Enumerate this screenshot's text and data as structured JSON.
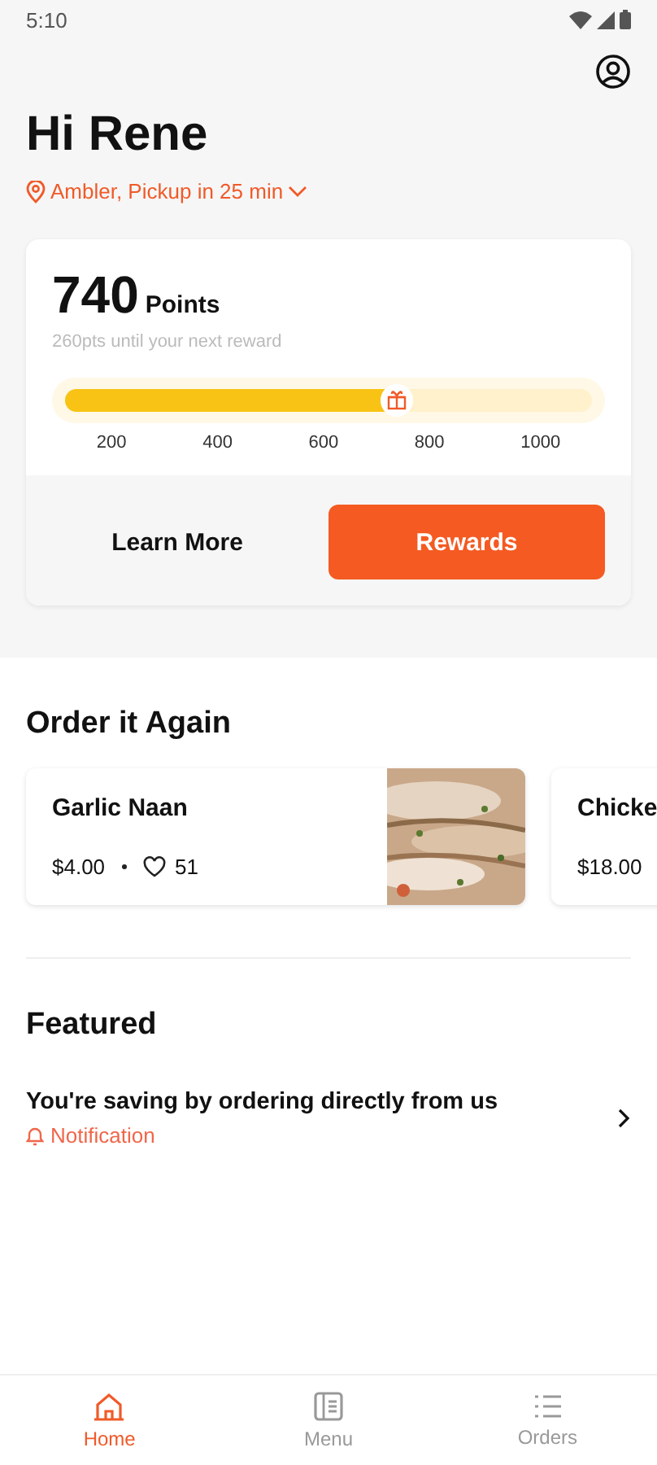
{
  "status_bar": {
    "time": "5:10"
  },
  "greeting": "Hi Rene",
  "location": "Ambler, Pickup in 25 min",
  "rewards": {
    "points": "740",
    "points_label": "Points",
    "subtitle": "260pts until your next reward",
    "level": 0.63,
    "ticks": [
      "200",
      "400",
      "600",
      "800",
      "1000"
    ],
    "learn_more": "Learn More",
    "rewards_button": "Rewards"
  },
  "order_again": {
    "title": "Order it Again",
    "items": [
      {
        "name": "Garlic Naan",
        "price": "$4.00",
        "likes": "51",
        "kind": "picture"
      },
      {
        "name": "Chicke",
        "price": "$18.00"
      }
    ]
  },
  "featured": {
    "title": "Featured",
    "items": [
      {
        "text": "You're saving by ordering directly from us",
        "tag": "Notification"
      }
    ]
  },
  "tabs": [
    {
      "label": "Home",
      "selected": true,
      "kind": "home"
    },
    {
      "label": "Menu",
      "selected": false,
      "kind": "menu"
    },
    {
      "label": "Orders",
      "selected": false,
      "kind": "orders"
    }
  ]
}
